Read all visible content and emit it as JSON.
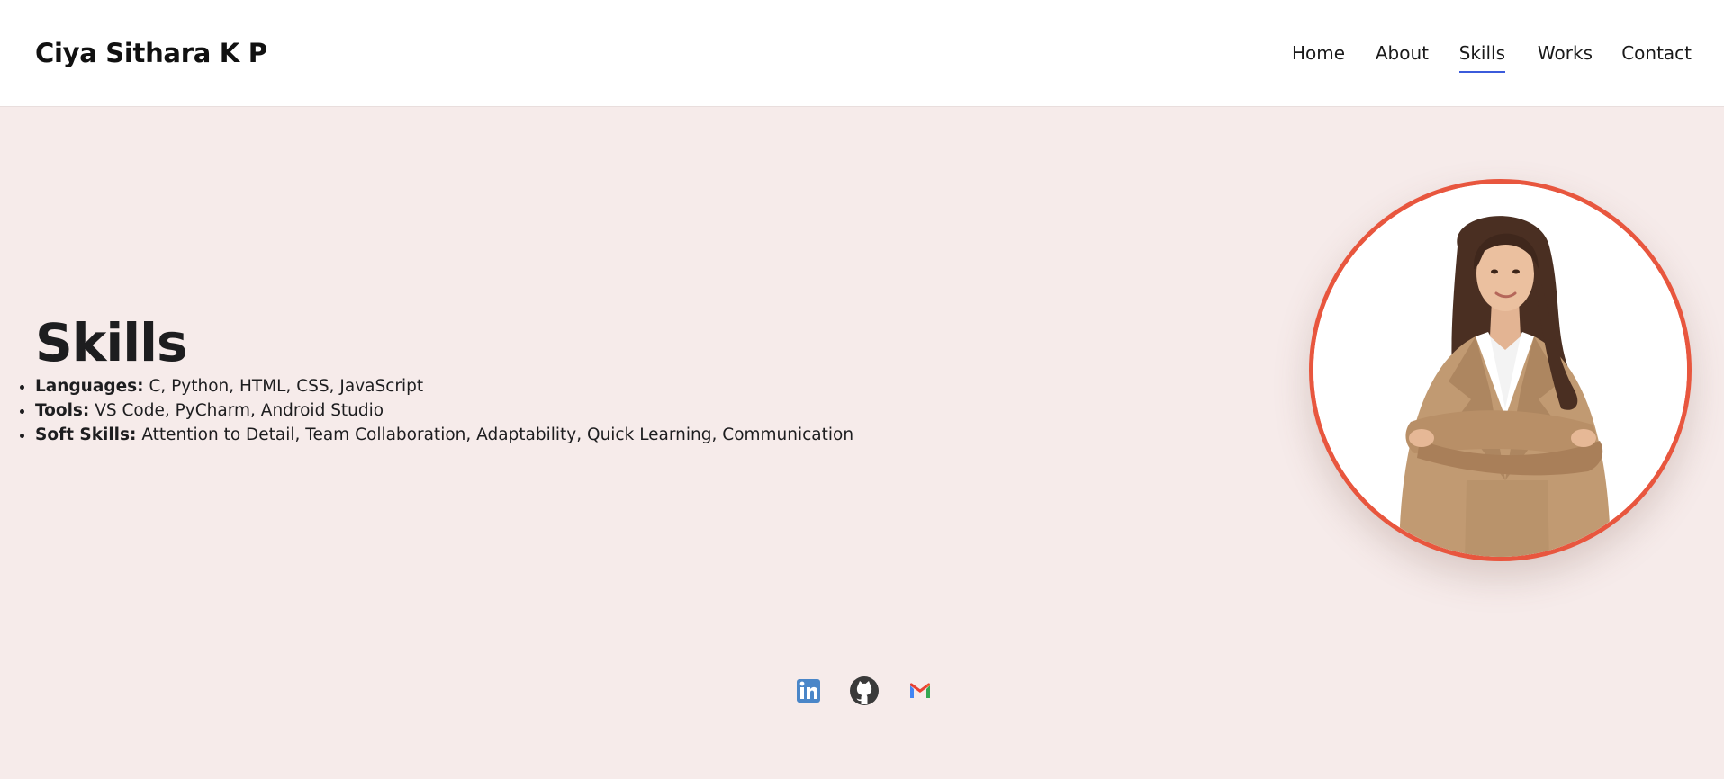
{
  "header": {
    "brand": "Ciya Sithara K P",
    "nav": [
      {
        "label": "Home",
        "active": false
      },
      {
        "label": "About",
        "active": false
      },
      {
        "label": "Skills",
        "active": true
      },
      {
        "label": "Works",
        "active": false
      },
      {
        "label": "Contact",
        "active": false
      }
    ]
  },
  "skills": {
    "title": "Skills",
    "items": [
      {
        "label": "Languages:",
        "value": "C, Python, HTML, CSS, JavaScript"
      },
      {
        "label": "Tools:",
        "value": "VS Code, PyCharm, Android Studio"
      },
      {
        "label": "Soft Skills:",
        "value": "Attention to Detail, Team Collaboration, Adaptability, Quick Learning, Communication"
      }
    ]
  },
  "profile_photo": {
    "icon": "profile-photo",
    "border_color": "#e8563e"
  },
  "socials": [
    {
      "icon": "linkedin-icon",
      "color": "#4a86c8"
    },
    {
      "icon": "github-icon",
      "color": "#3a3a3a"
    },
    {
      "icon": "gmail-icon",
      "color": "#ea4335"
    }
  ],
  "colors": {
    "page_background": "#f6ebea",
    "header_background": "#ffffff",
    "active_underline": "#3b5bdb"
  }
}
